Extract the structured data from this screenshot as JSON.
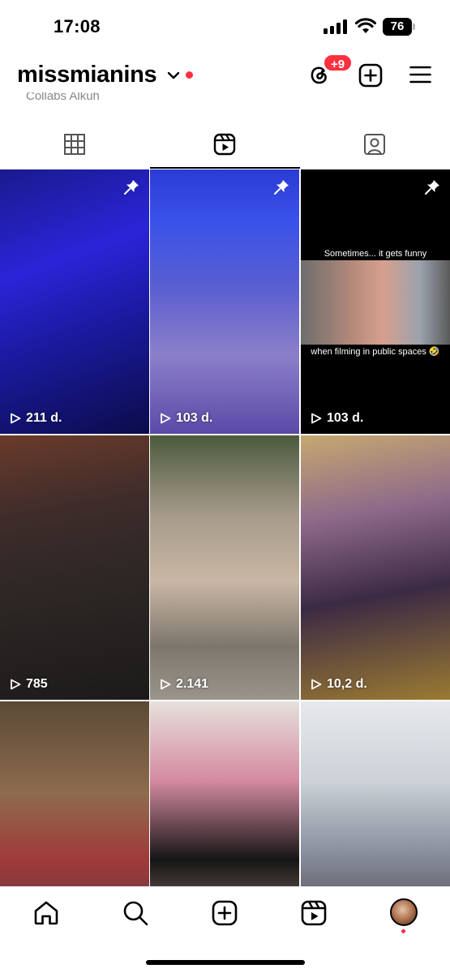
{
  "status_bar": {
    "time": "17:08",
    "battery": "76"
  },
  "header": {
    "username": "missmianins",
    "threads_badge": "+9",
    "cutoff_text": "Collabs        Alkuh"
  },
  "tabs": [
    {
      "name": "posts-grid",
      "active": false
    },
    {
      "name": "reels",
      "active": true
    },
    {
      "name": "tagged",
      "active": false
    }
  ],
  "reels": [
    {
      "views": "211 d.",
      "pinned": true
    },
    {
      "views": "103 d.",
      "pinned": true
    },
    {
      "views": "103 d.",
      "pinned": true,
      "caption_top": "Sometimes... it gets funny",
      "caption_bottom": "when filming in public spaces 🤣"
    },
    {
      "views": "785",
      "pinned": false
    },
    {
      "views": "2.141",
      "pinned": false
    },
    {
      "views": "10,2 d.",
      "pinned": false
    },
    {
      "views": "",
      "pinned": false
    },
    {
      "views": "",
      "pinned": false
    },
    {
      "views": "",
      "pinned": false
    }
  ],
  "bottom_nav": [
    "home-icon",
    "search-icon",
    "create-icon",
    "reels-icon",
    "profile-avatar"
  ],
  "colors": {
    "accent_red": "#ff3040",
    "text": "#000000",
    "background": "#ffffff"
  }
}
